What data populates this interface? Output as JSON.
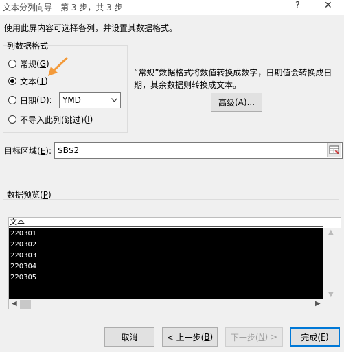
{
  "window": {
    "title": "文本分列向导 - 第 3 步，共 3 步",
    "help_glyph": "?",
    "close_glyph": "✕"
  },
  "intro": "使用此屏内容可选择各列，并设置其数据格式。",
  "column_format": {
    "group_title": "列数据格式",
    "options": [
      {
        "label": "常规",
        "hotkey": "G",
        "selected": false
      },
      {
        "label": "文本",
        "hotkey": "T",
        "selected": true
      },
      {
        "label": "日期",
        "hotkey": "D",
        "selected": false
      },
      {
        "label": "不导入此列(跳过)",
        "hotkey": "I",
        "selected": false
      }
    ],
    "date_format": "YMD"
  },
  "description": "“常规”数据格式将数值转换成数字，日期值会转换成日期，其余数据则转换成文本。",
  "advanced_button": {
    "label": "高级",
    "hotkey": "A",
    "suffix": "..."
  },
  "destination": {
    "label": "目标区域",
    "hotkey": "E",
    "value": "$B$2"
  },
  "preview": {
    "label": "数据预览",
    "hotkey": "P",
    "column_header": "文本",
    "rows": [
      "220301",
      "220302",
      "220303",
      "220304",
      "220305"
    ]
  },
  "buttons": {
    "cancel": "取消",
    "back": {
      "prefix": "< 上一步(",
      "hotkey": "B",
      "suffix": ")"
    },
    "next": {
      "prefix": "下一步(",
      "hotkey": "N",
      "suffix": ") >"
    },
    "finish": {
      "prefix": "完成(",
      "hotkey": "F",
      "suffix": ")"
    }
  },
  "colors": {
    "highlight_arrow": "#f39a3a",
    "preview_selected": "#000000",
    "primary_border": "#0078d7"
  }
}
